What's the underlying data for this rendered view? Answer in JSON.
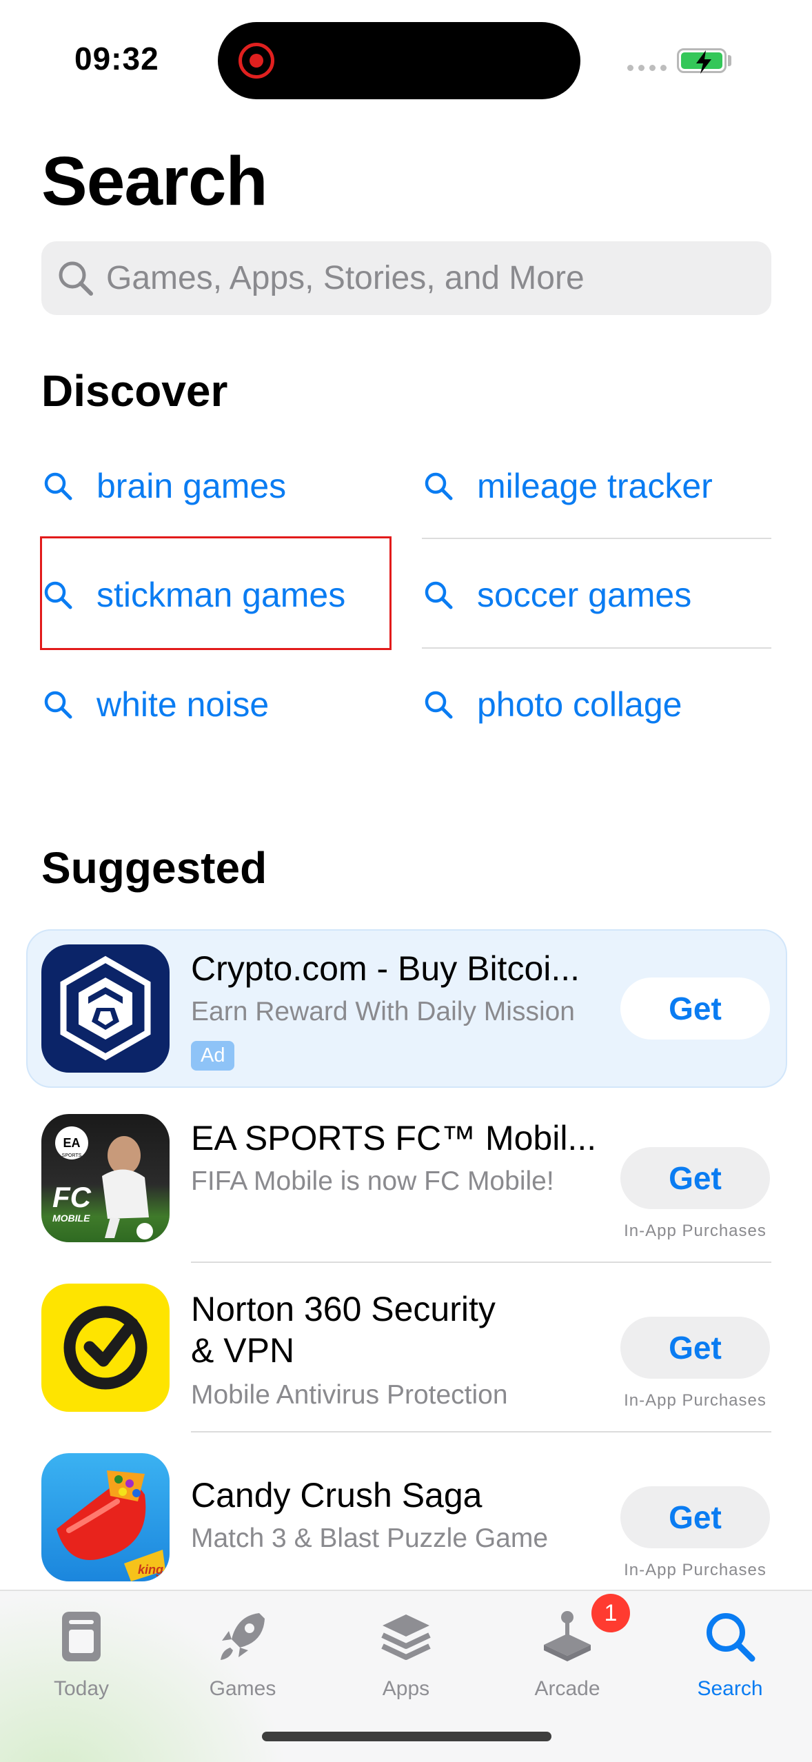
{
  "status": {
    "time": "09:32"
  },
  "page": {
    "title": "Search"
  },
  "search": {
    "placeholder": "Games, Apps, Stories, and More"
  },
  "discover": {
    "title": "Discover",
    "items": [
      "brain games",
      "mileage tracker",
      "stickman games",
      "soccer games",
      "white noise",
      "photo collage"
    ],
    "highlighted_item": "stickman games",
    "highlight_color": "#e21b1b"
  },
  "suggested": {
    "title": "Suggested",
    "apps": [
      {
        "name": "Crypto.com - Buy Bitcoi...",
        "subtitle": "Earn Reward With Daily Mission",
        "badge": "Ad",
        "button": "Get",
        "note": ""
      },
      {
        "name": "EA SPORTS FC™ Mobil...",
        "subtitle": "FIFA Mobile is now FC Mobile!",
        "button": "Get",
        "note": "In-App Purchases"
      },
      {
        "name_line1": "Norton 360 Security",
        "name_line2": "& VPN",
        "subtitle": "Mobile Antivirus Protection",
        "button": "Get",
        "note": "In-App Purchases"
      },
      {
        "name": "Candy Crush Saga",
        "subtitle": "Match 3 & Blast Puzzle Game",
        "button": "Get",
        "note": "In-App Purchases"
      }
    ]
  },
  "tabs": [
    {
      "label": "Today",
      "icon": "today-icon"
    },
    {
      "label": "Games",
      "icon": "rocket-icon"
    },
    {
      "label": "Apps",
      "icon": "apps-stack-icon"
    },
    {
      "label": "Arcade",
      "icon": "joystick-icon",
      "badge": "1"
    },
    {
      "label": "Search",
      "icon": "search-icon",
      "active": true
    }
  ],
  "colors": {
    "accent": "#0a7cf2",
    "badge": "#ff3b30",
    "battery": "#34c759"
  }
}
